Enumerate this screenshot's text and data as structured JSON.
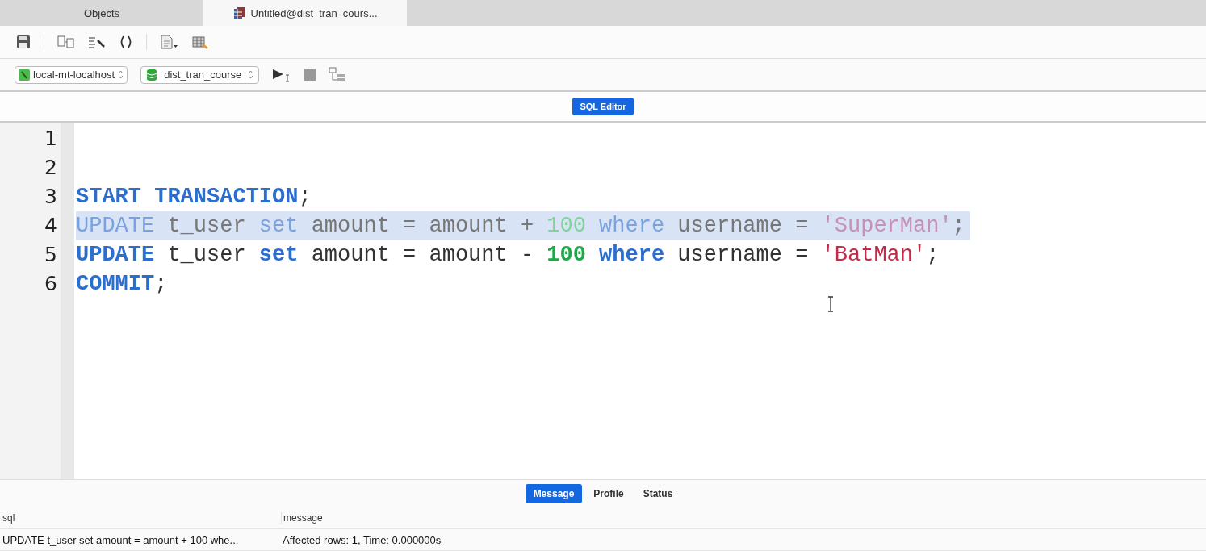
{
  "tabs": [
    {
      "label": "Objects",
      "selected": false
    },
    {
      "label": "Untitled@dist_tran_cours...",
      "selected": true
    }
  ],
  "connection": {
    "server": "local-mt-localhost",
    "database": "dist_tran_course"
  },
  "mode_label": "SQL Editor",
  "editor": {
    "lines": [
      {
        "number": "1",
        "selected": false
      },
      {
        "number": "2",
        "selected": false
      },
      {
        "number": "3",
        "selected": false,
        "tokens": [
          {
            "kind": "keyword",
            "text": "START TRANSACTION"
          },
          {
            "kind": "plain",
            "text": ";"
          }
        ]
      },
      {
        "number": "4",
        "selected": true,
        "tokens": [
          {
            "kind": "keyword",
            "text": "UPDATE"
          },
          {
            "kind": "plain",
            "text": " t_user "
          },
          {
            "kind": "keyword",
            "text": "set"
          },
          {
            "kind": "plain",
            "text": " amount = amount + "
          },
          {
            "kind": "number",
            "text": "100"
          },
          {
            "kind": "keyword",
            "text": " where"
          },
          {
            "kind": "plain",
            "text": " username = "
          },
          {
            "kind": "string",
            "text": "'SuperMan'"
          },
          {
            "kind": "plain",
            "text": ";"
          }
        ]
      },
      {
        "number": "5",
        "selected": false,
        "tokens": [
          {
            "kind": "keyword",
            "text": "UPDATE"
          },
          {
            "kind": "plain",
            "text": " t_user "
          },
          {
            "kind": "keyword",
            "text": "set"
          },
          {
            "kind": "plain",
            "text": " amount = amount - "
          },
          {
            "kind": "number",
            "text": "100"
          },
          {
            "kind": "keyword",
            "text": " where"
          },
          {
            "kind": "plain",
            "text": " username = "
          },
          {
            "kind": "string",
            "text": "'BatMan'"
          },
          {
            "kind": "plain",
            "text": ";"
          }
        ]
      },
      {
        "number": "6",
        "selected": false,
        "tokens": [
          {
            "kind": "keyword",
            "text": "COMMIT"
          },
          {
            "kind": "plain",
            "text": ";"
          }
        ]
      }
    ]
  },
  "result_tabs": [
    {
      "label": "Message",
      "selected": true
    },
    {
      "label": "Profile",
      "selected": false
    },
    {
      "label": "Status",
      "selected": false
    }
  ],
  "result_table": {
    "columns": [
      "sql",
      "message"
    ],
    "rows": [
      [
        "UPDATE t_user set amount = amount + 100 whe...",
        "Affected rows: 1, Time: 0.000000s"
      ]
    ]
  }
}
